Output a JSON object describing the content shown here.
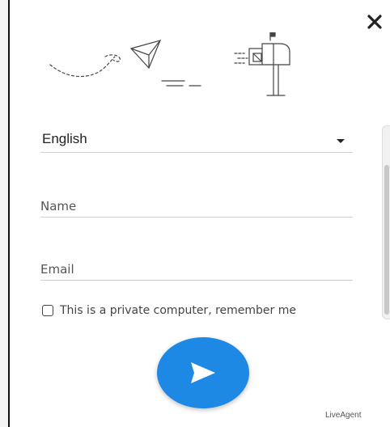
{
  "form": {
    "language": {
      "selected": "English",
      "icon": "caret-down-icon"
    },
    "name_placeholder": "Name",
    "email_placeholder": "Email",
    "remember_label": "This is a private computer, remember me",
    "remember_checked": false
  },
  "send_button": {
    "icon": "send-arrow-icon",
    "color": "#1e88e5"
  },
  "branding": "LiveAgent",
  "close_icon": "close-icon",
  "illustration": {
    "paper_plane": "paper-plane-icon",
    "mailbox": "mailbox-icon"
  }
}
